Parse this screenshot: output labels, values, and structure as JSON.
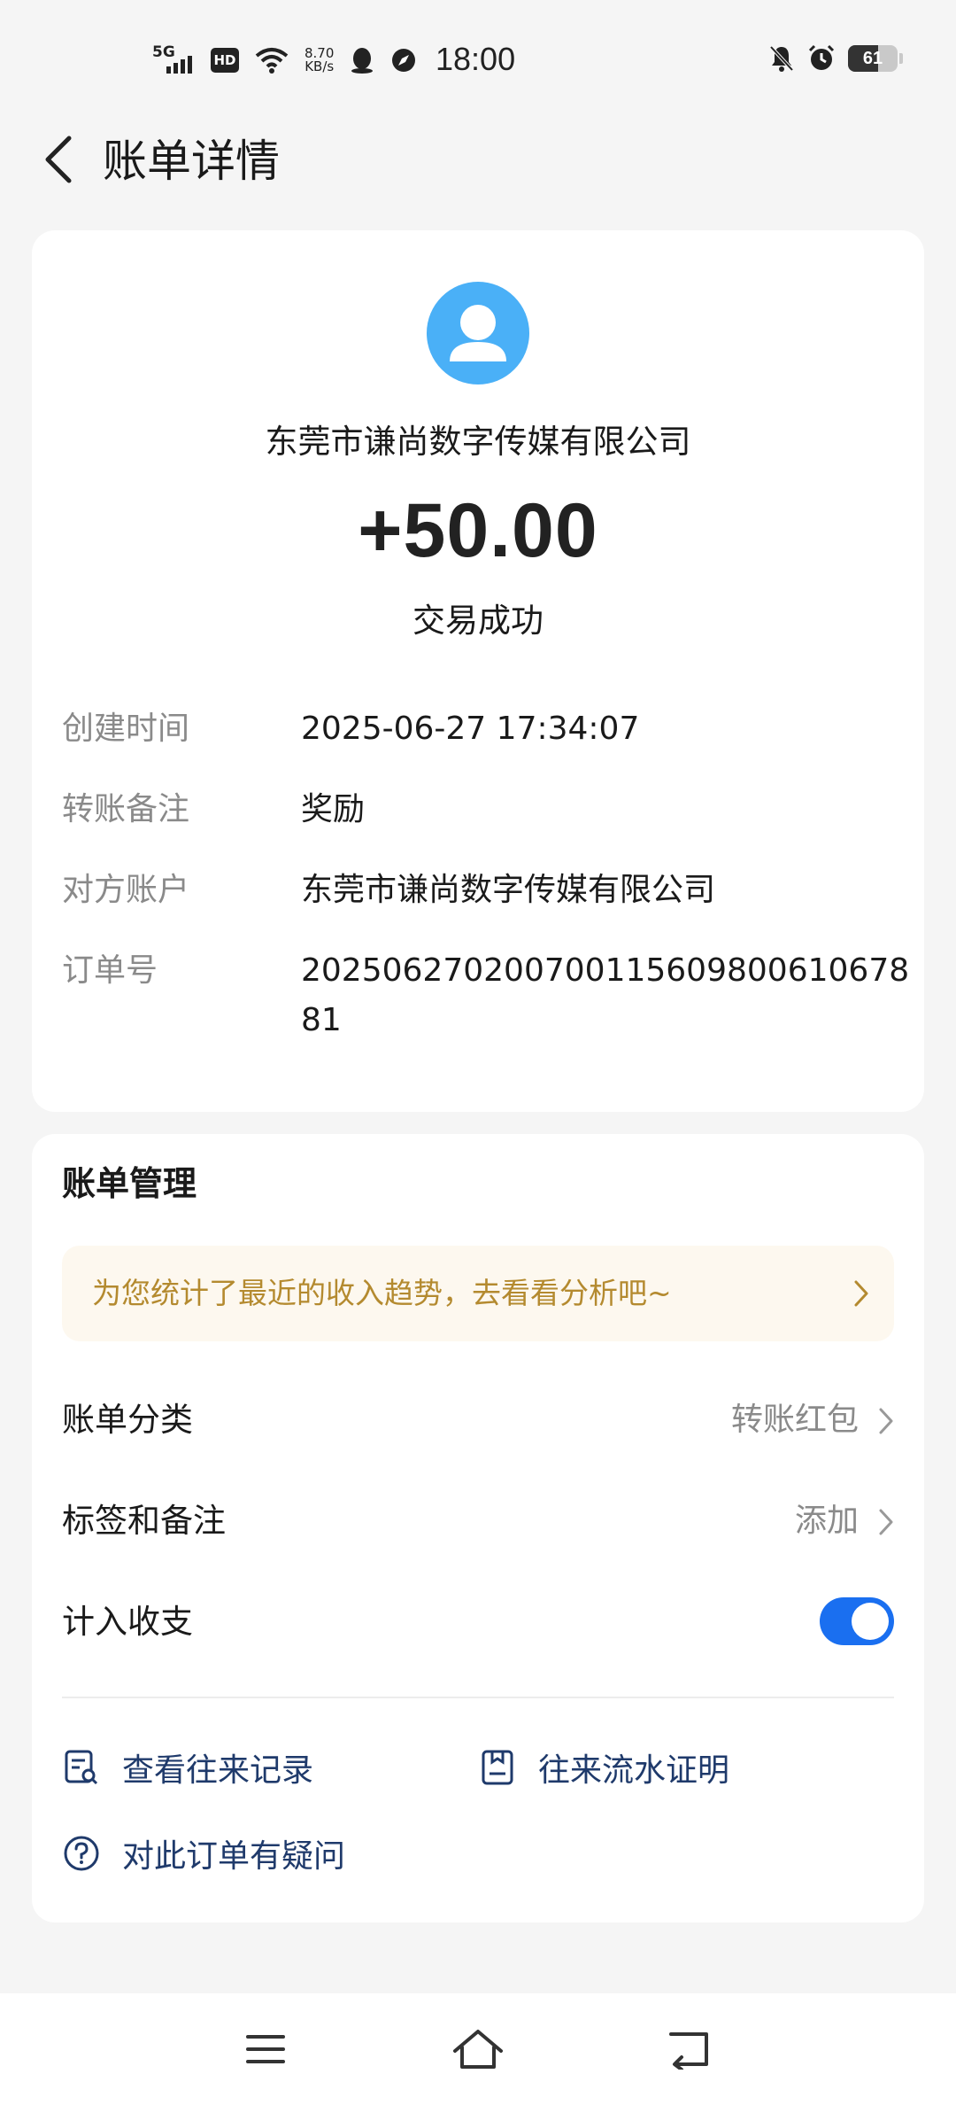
{
  "status_bar": {
    "network": "5G",
    "hd": "HD",
    "speed_value": "8.70",
    "speed_unit": "KB/s",
    "time": "18:00",
    "battery": "61",
    "battery_level": 0.61,
    "icons": [
      "signal-icon",
      "hd-icon",
      "wifi-icon",
      "qq-icon",
      "compass-app-icon",
      "bell-muted-icon",
      "alarm-icon",
      "battery-icon"
    ]
  },
  "header": {
    "title": "账单详情",
    "back_icon": "chevron-left-icon"
  },
  "summary": {
    "payer_name": "东莞市谦尚数字传媒有限公司",
    "amount": "+50.00",
    "status": "交易成功",
    "avatar_icon": "user-avatar-icon",
    "avatar_color": "#4ab0f7"
  },
  "details": [
    {
      "label": "创建时间",
      "value": "2025-06-27 17:34:07"
    },
    {
      "label": "转账备注",
      "value": "奖励"
    },
    {
      "label": "对方账户",
      "value": "东莞市谦尚数字传媒有限公司"
    },
    {
      "label": "订单号",
      "value": "20250627020070011560980061067881"
    }
  ],
  "management": {
    "title": "账单管理",
    "promo_text": "为您统计了最近的收入趋势，去看看分析吧~",
    "promo_color": "#b48a2f",
    "rows": {
      "category": {
        "label": "账单分类",
        "value": "转账红包"
      },
      "tags": {
        "label": "标签和备注",
        "value": "添加"
      },
      "include": {
        "label": "计入收支",
        "enabled": true
      }
    },
    "toggle_color": "#1a6ff0",
    "links": {
      "history": "查看往来记录",
      "proof": "往来流水证明",
      "question": "对此订单有疑问"
    }
  },
  "nav": {
    "icons": [
      "menu-icon",
      "home-icon",
      "back-nav-icon"
    ]
  }
}
